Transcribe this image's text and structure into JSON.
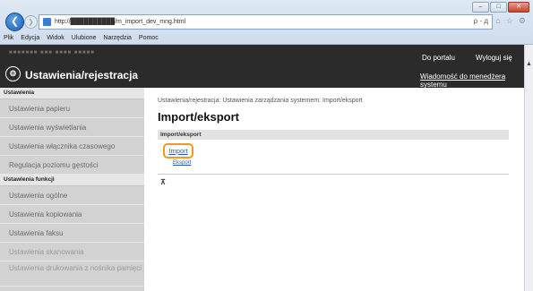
{
  "browser": {
    "url": "http://██████████/m_import_dev_mng.html",
    "addr_tools": "ρ - д",
    "menu": [
      "Plik",
      "Edycja",
      "Widok",
      "Ulubione",
      "Narzędzia",
      "Pomoc"
    ]
  },
  "header": {
    "app_title": "Ustawienia/rejestracja",
    "portal_link": "Do portalu",
    "logout_link": "Wyloguj się",
    "mail_link": "Wiadomość do menedżera systemu"
  },
  "sidebar": {
    "section1": "Ustawienia",
    "items1": [
      "Ustawienia papieru",
      "Ustawienia wyświetlania",
      "Ustawienia włącznika czasowego",
      "Regulacja poziomu gęstości"
    ],
    "section2": "Ustawienia funkcji",
    "items2": [
      "Ustawienia ogólne",
      "Ustawienia kopiowania",
      "Ustawienia faksu",
      "Ustawienia skanowania",
      "Ustawienia drukowania z nośnika pamięci"
    ]
  },
  "main": {
    "breadcrumb": "Ustawienia/rejestracja: Ustawienia zarządzania systemem: Import/eksport",
    "title": "Import/eksport",
    "panel_title": "Import/eksport",
    "import": "Import",
    "export": "Eksport"
  }
}
